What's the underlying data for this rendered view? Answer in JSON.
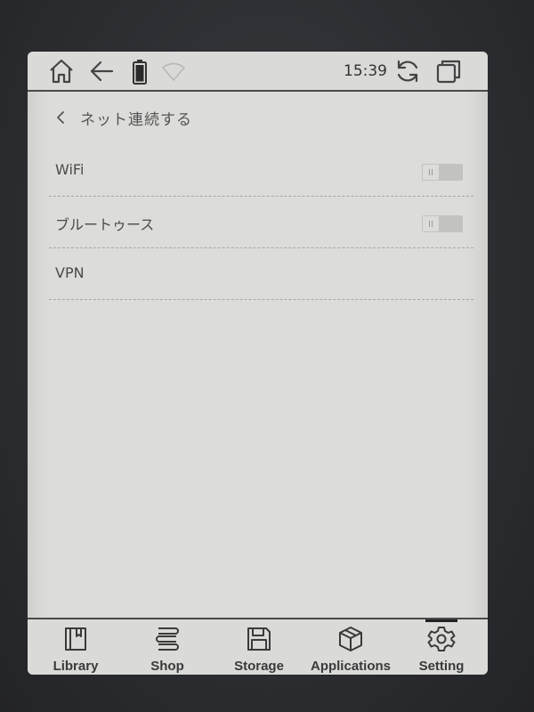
{
  "statusbar": {
    "time": "15:39",
    "icons": [
      "home-icon",
      "back-arrow-icon",
      "battery-icon",
      "wifi-signal-icon",
      "refresh-icon",
      "window-switch-icon"
    ]
  },
  "header": {
    "title": "ネット連続する"
  },
  "settings": {
    "items": [
      {
        "label": "WiFi",
        "has_toggle": true,
        "toggle_on": false
      },
      {
        "label": "ブルートゥース",
        "has_toggle": true,
        "toggle_on": false
      },
      {
        "label": "VPN",
        "has_toggle": false
      }
    ]
  },
  "bottomnav": {
    "items": [
      {
        "label": "Library",
        "icon": "book-icon"
      },
      {
        "label": "Shop",
        "icon": "stacked-books-icon"
      },
      {
        "label": "Storage",
        "icon": "floppy-disk-icon"
      },
      {
        "label": "Applications",
        "icon": "cube-icon"
      },
      {
        "label": "Setting",
        "icon": "gear-icon"
      }
    ],
    "active": "Setting"
  }
}
